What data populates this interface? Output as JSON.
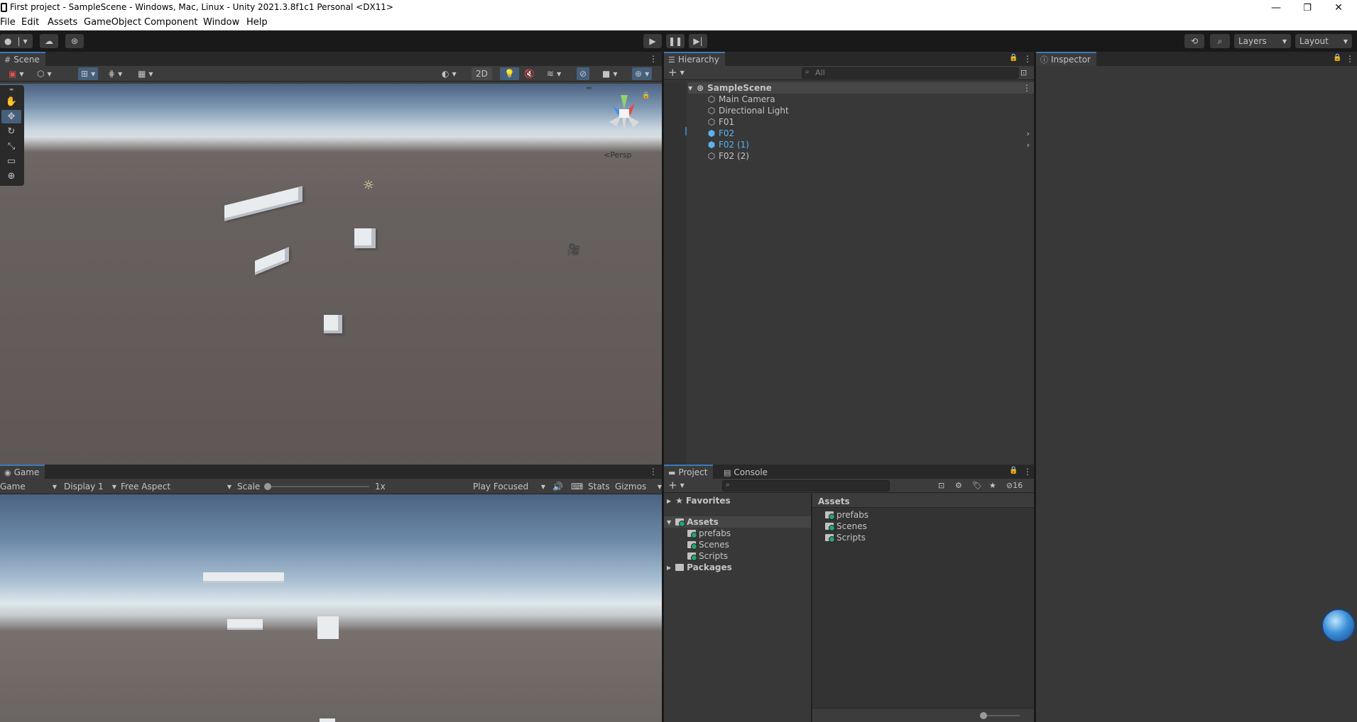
{
  "window": {
    "title": "First project - SampleScene - Windows, Mac, Linux - Unity 2021.3.8f1c1 Personal <DX11>",
    "controls": {
      "minimize": "—",
      "restore": "❐",
      "close": "✕"
    }
  },
  "menu": [
    "File",
    "Edit",
    "Assets",
    "GameObject",
    "Component",
    "Window",
    "Help"
  ],
  "toolbar": {
    "layers_label": "Layers",
    "layout_label": "Layout"
  },
  "scene": {
    "tab_label": "Scene",
    "toggle_2d": "2D",
    "persp_label": "Persp"
  },
  "game": {
    "tab_label": "Game",
    "mode": "Game",
    "display": "Display 1",
    "aspect": "Free Aspect",
    "scale_label": "Scale",
    "scale_value": "1x",
    "scale_fraction": 0.0,
    "play_mode": "Play Focused",
    "stats_label": "Stats",
    "gizmos_label": "Gizmos"
  },
  "hierarchy": {
    "tab_label": "Hierarchy",
    "search_placeholder": "All",
    "scene_name": "SampleScene",
    "items": [
      {
        "label": "Main Camera",
        "prefab": false,
        "has_children": false
      },
      {
        "label": "Directional Light",
        "prefab": false,
        "has_children": false
      },
      {
        "label": "F01",
        "prefab": false,
        "has_children": false
      },
      {
        "label": "F02",
        "prefab": true,
        "has_children": true
      },
      {
        "label": "F02 (1)",
        "prefab": true,
        "has_children": true
      },
      {
        "label": "F02 (2)",
        "prefab": false,
        "has_children": false
      }
    ]
  },
  "inspector": {
    "tab_label": "Inspector"
  },
  "project": {
    "tab_label": "Project",
    "console_tab_label": "Console",
    "hidden_count": "16",
    "tree": {
      "favorites": "Favorites",
      "assets": "Assets",
      "children": [
        "prefabs",
        "Scenes",
        "Scripts"
      ],
      "packages": "Packages"
    },
    "content_header": "Assets",
    "content_items": [
      "prefabs",
      "Scenes",
      "Scripts"
    ]
  },
  "colors": {
    "accent_blue": "#3a79bb",
    "prefab_blue": "#5ab3f0",
    "panel_bg": "#383838",
    "tab_bg": "#282828"
  }
}
